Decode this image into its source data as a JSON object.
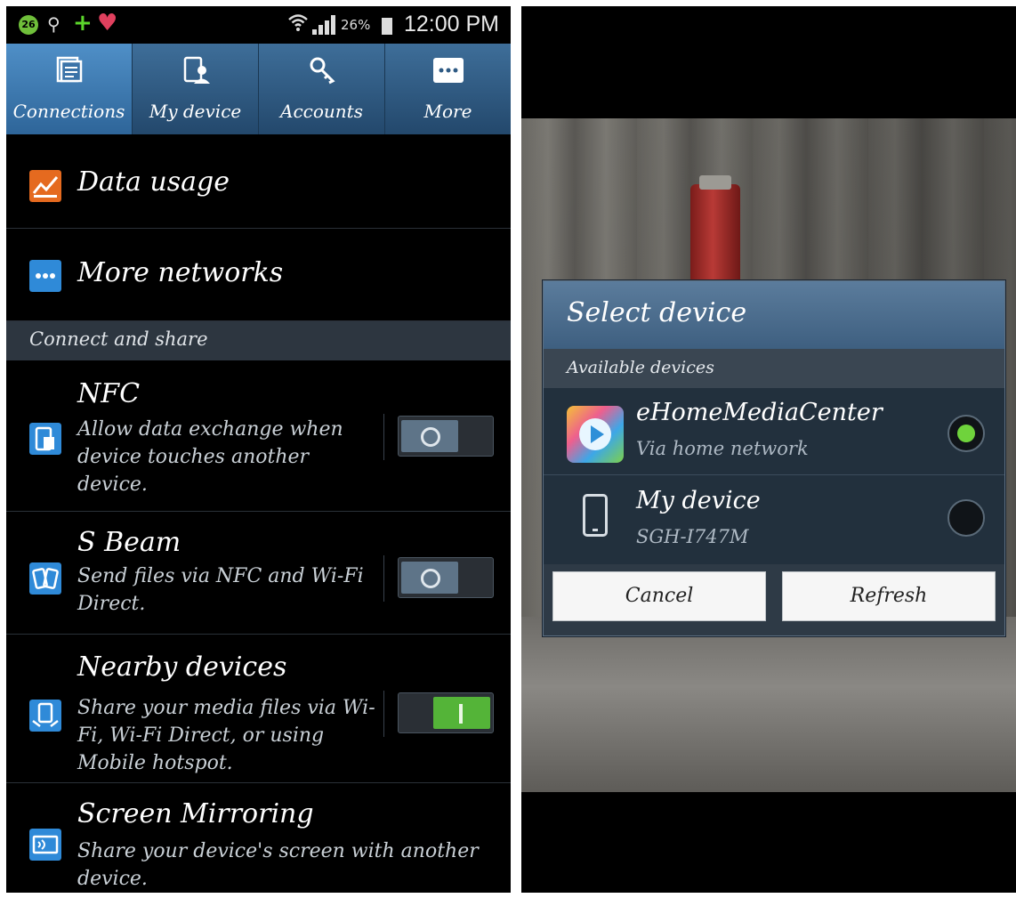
{
  "status_bar": {
    "notification_count": "26",
    "battery": "26%",
    "time": "12:00 PM"
  },
  "tabs": [
    {
      "label": "Connections",
      "icon": "connections-icon",
      "active": true
    },
    {
      "label": "My device",
      "icon": "my-device-icon",
      "active": false
    },
    {
      "label": "Accounts",
      "icon": "accounts-icon",
      "active": false
    },
    {
      "label": "More",
      "icon": "more-icon",
      "active": false
    }
  ],
  "settings": {
    "data_usage": {
      "title": "Data usage",
      "icon": "chart-icon"
    },
    "more_networks": {
      "title": "More networks",
      "icon": "dots-icon"
    },
    "section_header": "Connect and share",
    "nfc": {
      "title": "NFC",
      "subtitle": "Allow data exchange when device touches another device.",
      "enabled": false
    },
    "s_beam": {
      "title": "S Beam",
      "subtitle": "Send files via NFC and Wi-Fi Direct.",
      "enabled": false
    },
    "nearby_devices": {
      "title": "Nearby devices",
      "subtitle": "Share your media files via Wi-Fi, Wi-Fi Direct, or using Mobile hotspot.",
      "enabled": true
    },
    "screen_mirroring": {
      "title": "Screen Mirroring",
      "subtitle": "Share your device's screen with another device."
    }
  },
  "dialog": {
    "title": "Select device",
    "subheader": "Available devices",
    "devices": [
      {
        "name": "eHomeMediaCenter",
        "subtitle": "Via home network",
        "selected": true,
        "icon": "media-center-icon"
      },
      {
        "name": "My device",
        "subtitle": "SGH-I747M",
        "selected": false,
        "icon": "phone-icon"
      }
    ],
    "cancel_label": "Cancel",
    "refresh_label": "Refresh"
  },
  "colors": {
    "tab_bar": "#2e5a84",
    "toggle_on": "#54b438",
    "radio_selected": "#6fd33c",
    "section_header_bg": "#2d3640"
  }
}
